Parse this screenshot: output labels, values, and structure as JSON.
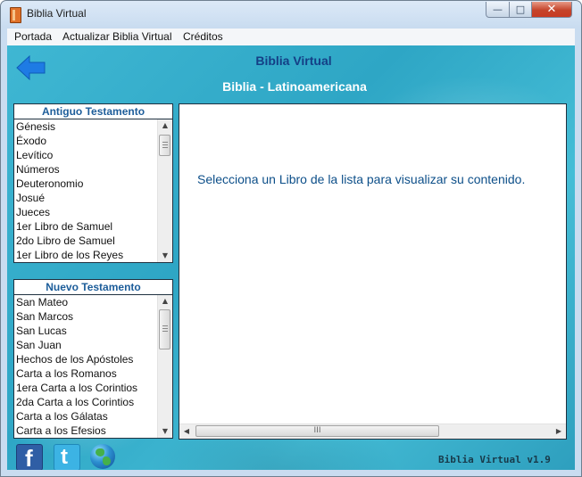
{
  "window": {
    "title": "Biblia Virtual",
    "buttons": {
      "minimize": "—",
      "maximize": "□",
      "close": "✕"
    }
  },
  "menu": [
    "Portada",
    "Actualizar Biblia Virtual",
    "Créditos"
  ],
  "header": {
    "app_title": "Biblia Virtual",
    "bible_title": "Biblia - Latinoamericana",
    "back_icon": "back-arrow-icon"
  },
  "old_testament": {
    "title": "Antiguo Testamento",
    "books": [
      "Génesis",
      "Éxodo",
      "Levítico",
      "Números",
      "Deuteronomio",
      "Josué",
      "Jueces",
      "1er Libro de Samuel",
      "2do Libro de Samuel",
      "1er Libro de los Reyes"
    ]
  },
  "new_testament": {
    "title": "Nuevo Testamento",
    "books": [
      "San Mateo",
      "San Marcos",
      "San Lucas",
      "San Juan",
      "Hechos de los Apóstoles",
      "Carta a los Romanos",
      "1era Carta a los Corintios",
      "2da Carta a los Corintios",
      "Carta a los Gálatas",
      "Carta a los Efesios"
    ]
  },
  "content": {
    "message": "Selecciona un Libro de la lista para visualizar su contenido.",
    "hscroll_grip": "III"
  },
  "footer": {
    "icons": [
      "facebook-icon",
      "twitter-icon",
      "globe-icon"
    ],
    "version": "Biblia Virtual v1.9"
  },
  "colors": {
    "accent": "#1d5d9a",
    "background": "#3fb7d3",
    "title_blue": "#143f86"
  }
}
